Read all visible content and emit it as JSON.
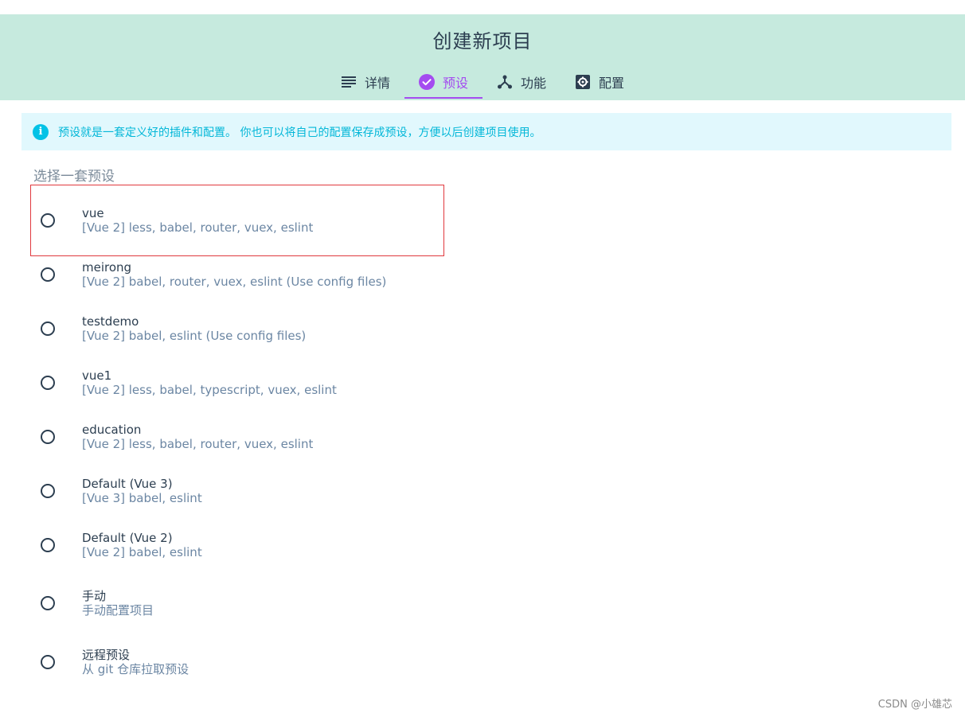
{
  "header": {
    "title": "创建新项目",
    "background_color": "#c6eade",
    "tabs": [
      {
        "label": "详情",
        "icon": "list-icon",
        "active": false
      },
      {
        "label": "预设",
        "icon": "check-circle-icon",
        "active": true
      },
      {
        "label": "功能",
        "icon": "fork-icon",
        "active": false
      },
      {
        "label": "配置",
        "icon": "gear-icon",
        "active": false
      }
    ],
    "active_color": "#a44cf0"
  },
  "info": {
    "icon": "info-icon",
    "text": "预设就是一套定义好的插件和配置。 你也可以将自己的配置保存成预设，方便以后创建项目使用。"
  },
  "section_label": "选择一套预设",
  "presets": [
    {
      "name": "vue",
      "desc": "[Vue 2] less, babel, router, vuex, eslint",
      "highlighted": true
    },
    {
      "name": "meirong",
      "desc": "[Vue 2] babel, router, vuex, eslint (Use config files)"
    },
    {
      "name": "testdemo",
      "desc": "[Vue 2] babel, eslint (Use config files)"
    },
    {
      "name": "vue1",
      "desc": "[Vue 2] less, babel, typescript, vuex, eslint"
    },
    {
      "name": "education",
      "desc": "[Vue 2] less, babel, router, vuex, eslint"
    },
    {
      "name": "Default (Vue 3)",
      "desc": "[Vue 3] babel, eslint"
    },
    {
      "name": "Default (Vue 2)",
      "desc": "[Vue 2] babel, eslint"
    },
    {
      "name": "手动",
      "desc": "手动配置项目"
    },
    {
      "name": "远程预设",
      "desc": "从 git 仓库拉取预设"
    }
  ],
  "watermark": "CSDN @小雄芯"
}
